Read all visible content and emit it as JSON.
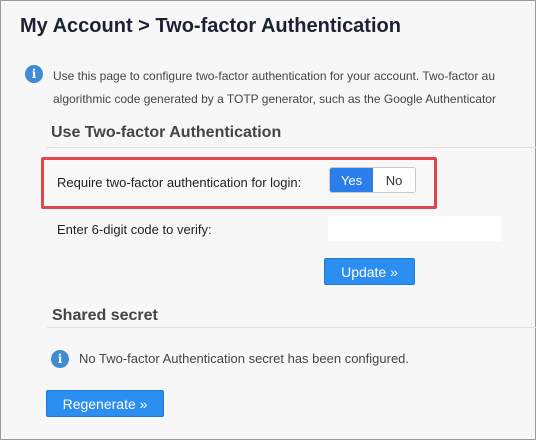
{
  "header": {
    "breadcrumb_root": "My Account",
    "separator": ">",
    "title": "Two-factor Authentication"
  },
  "intro": {
    "line1": "Use this page to configure two-factor authentication for your account. Two-factor au",
    "line2": "algorithmic code generated by a TOTP generator, such as the Google Authenticator"
  },
  "use_2fa": {
    "section_title": "Use Two-factor Authentication",
    "require_label": "Require two-factor authentication for login:",
    "toggle": {
      "yes_label": "Yes",
      "no_label": "No",
      "selected": "Yes"
    },
    "code_label": "Enter 6-digit code to verify:",
    "code_value": "",
    "update_button": "Update »"
  },
  "shared_secret": {
    "section_title": "Shared secret",
    "message": "No Two-factor Authentication secret has been configured.",
    "regenerate_button": "Regenerate »"
  },
  "colors": {
    "accent": "#2b8ef0",
    "toggle_selected": "#2b7de9",
    "highlight_border": "#e0474c",
    "info_icon": "#3f8bd6"
  },
  "icons": [
    "info-icon"
  ]
}
